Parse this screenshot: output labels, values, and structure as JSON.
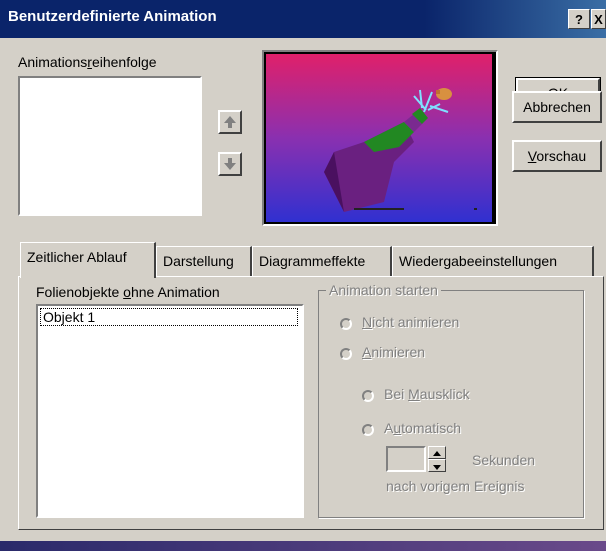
{
  "window": {
    "title": "Benutzerdefinierte Animation",
    "help_label": "?",
    "close_label": "X"
  },
  "order": {
    "label_pre": "Animations",
    "label_u": "r",
    "label_post": "eihenfolge"
  },
  "buttons": {
    "ok": "OK",
    "cancel": "Abbrechen",
    "preview_u": "V",
    "preview_rest": "orschau"
  },
  "tabs": [
    {
      "label": "Zeitlicher Ablauf"
    },
    {
      "label": "Darstellung"
    },
    {
      "label": "Diagrammeffekte"
    },
    {
      "label": "Wiedergabeeinstellungen"
    }
  ],
  "objects": {
    "label_pre": "Folienobjekte ",
    "label_u": "o",
    "label_post": "hne Animation",
    "items": [
      "Objekt 1"
    ]
  },
  "start_group": {
    "title": "Animation starten",
    "options": {
      "no_anim": {
        "u": "N",
        "rest": "icht animieren"
      },
      "anim": {
        "u": "A",
        "rest": "nimieren"
      },
      "click": {
        "pre": "Bei ",
        "u": "M",
        "rest": "ausklick"
      },
      "auto": {
        "pre": "A",
        "u": "u",
        "rest": "tomatisch"
      }
    },
    "seconds_label": "Sekunden",
    "after_label": "nach vorigem Ereignis"
  },
  "colors": {
    "title_bar": "#0a246a",
    "face": "#d4d0c8",
    "preview_bg_top": "#d0207a",
    "preview_bg_bottom": "#3a3ad0"
  }
}
